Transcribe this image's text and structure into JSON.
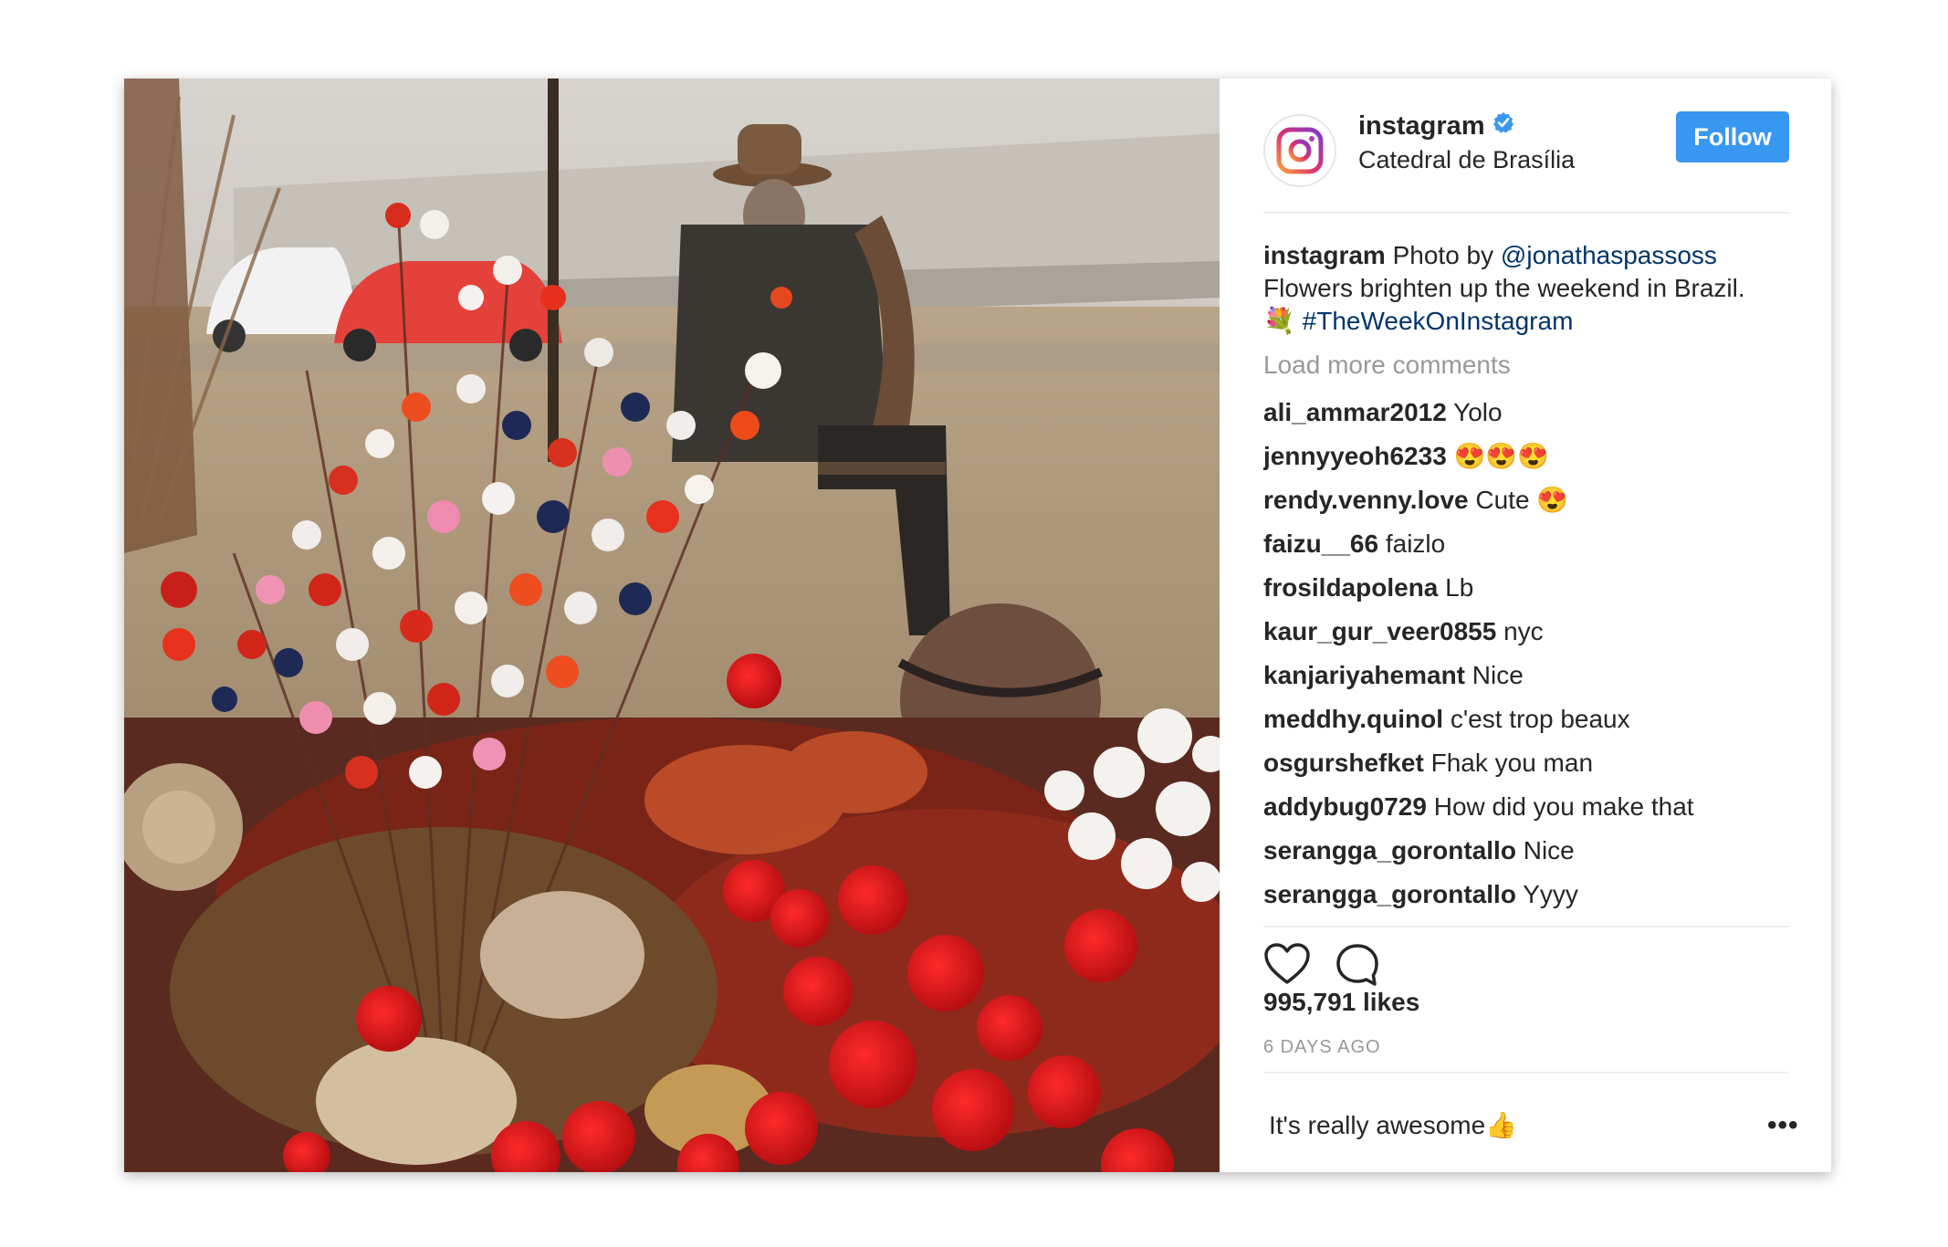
{
  "post": {
    "username": "instagram",
    "location": "Catedral de Brasília",
    "follow_label": "Follow",
    "caption": {
      "username": "instagram",
      "text_before": " Photo by ",
      "mention": "@jonathaspassoss",
      "text_line2": "Flowers brighten up the weekend in Brazil.",
      "emoji": "💐",
      "hashtag": "#TheWeekOnInstagram"
    },
    "load_more_label": "Load more comments",
    "comments": [
      {
        "user": "ali_ammar2012",
        "text": "Yolo"
      },
      {
        "user": "jennyyeoh6233",
        "text": "😍😍😍"
      },
      {
        "user": "rendy.venny.love",
        "text": "Cute 😍"
      },
      {
        "user": "faizu__66",
        "text": "faizlo"
      },
      {
        "user": "frosildapolena",
        "text": "Lb"
      },
      {
        "user": "kaur_gur_veer0855",
        "text": "nyc"
      },
      {
        "user": "kanjariyahemant",
        "text": "Nice"
      },
      {
        "user": "meddhy.quinol",
        "text": "c'est trop beaux"
      },
      {
        "user": "osgurshefket",
        "text": "Fhak you man"
      },
      {
        "user": "addybug0729",
        "text": "How did you make that"
      },
      {
        "user": "serangga_gorontallo",
        "text": "Nice"
      },
      {
        "user": "serangga_gorontallo",
        "text": "Yyyy"
      }
    ],
    "likes": "995,791 likes",
    "date": "6 DAYS AGO",
    "comment_input_value": "It's really awesome👍",
    "more_label": "•••"
  },
  "icons": {
    "profile": "instagram-logo-icon",
    "verified": "verified-badge-icon",
    "like": "heart-icon",
    "comment": "comment-bubble-icon",
    "more": "more-options-icon"
  },
  "colors": {
    "follow_button": "#3897f0",
    "link": "#003569",
    "muted": "#999999",
    "verified": "#3897f0"
  }
}
